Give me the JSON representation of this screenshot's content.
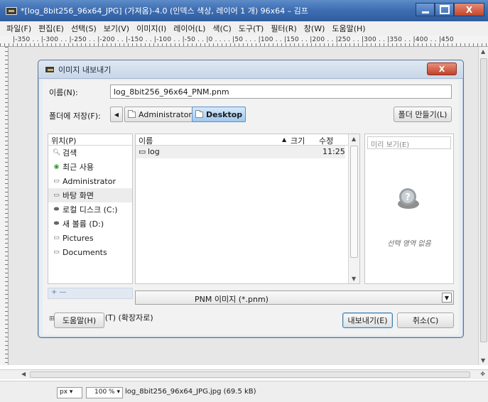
{
  "window": {
    "title": "*[log_8bit256_96x64_JPG] (가져옴)-4.0 (인덱스 색상, 레이어 1 개) 96x64 – 김프",
    "minimize_icon": "minimize-icon",
    "maximize_icon": "maximize-icon",
    "close_label": "X"
  },
  "menu": [
    "파일(F)",
    "편집(E)",
    "선택(S)",
    "보기(V)",
    "이미지(I)",
    "레이어(L)",
    "색(C)",
    "도구(T)",
    "필터(R)",
    "창(W)",
    "도움말(H)"
  ],
  "ruler": {
    "h_labels": "|-350 . . |-300 . . |-250 . . |-200 . . |-150 . . |-100 . . |-50 . . |0 . . . . |50 . . . |100 . . |150 . . |200 . . |250 . . |300 . . |350 . . |400 . . |450"
  },
  "dialog": {
    "title": "이미지 내보내기",
    "close_label": "X",
    "name_label": "이름(N):",
    "name_value": "log_8bit256_96x64_PNM.pnm",
    "folder_label": "폴더에 저장(F):",
    "back_arrow": "◀",
    "breadcrumbs": [
      "Administrator",
      "Desktop"
    ],
    "create_folder": "폴더 만들기(L)",
    "places_header": "위치(P)",
    "places": [
      {
        "label": "검색",
        "icon": "search-icon"
      },
      {
        "label": "최근 사용",
        "icon": "recent-icon"
      },
      {
        "label": "Administrator",
        "icon": "folder-icon"
      },
      {
        "label": "바탕 화면",
        "icon": "folder-icon"
      },
      {
        "label": "로컬 디스크 (C:)",
        "icon": "drive-icon"
      },
      {
        "label": "새 볼륨 (D:)",
        "icon": "drive-icon"
      },
      {
        "label": "Pictures",
        "icon": "folder-icon"
      },
      {
        "label": "Documents",
        "icon": "folder-icon"
      }
    ],
    "places_toolbar": "+   —",
    "columns": {
      "name": "이름",
      "size": "크기",
      "modified": "수정"
    },
    "files": [
      {
        "name": "log",
        "size": "",
        "modified": "11:25"
      }
    ],
    "preview_label": "미리 보기(E)",
    "preview_empty": "선택 영역 없음",
    "file_type": "PNM 이미지 (*.pnm)",
    "select_type": "파일 유형 선택(T) (확장자로)",
    "help": "도움말(H)",
    "export": "내보내기(E)",
    "cancel": "취소(C)"
  },
  "status": {
    "unit": "px",
    "zoom": "100 %",
    "file_info": "log_8bit256_96x64_JPG.jpg (69.5 kB)"
  },
  "colors": {
    "titlebar": "#3f6fb3",
    "selection": "#9fc8ee",
    "close": "#c4452a"
  }
}
